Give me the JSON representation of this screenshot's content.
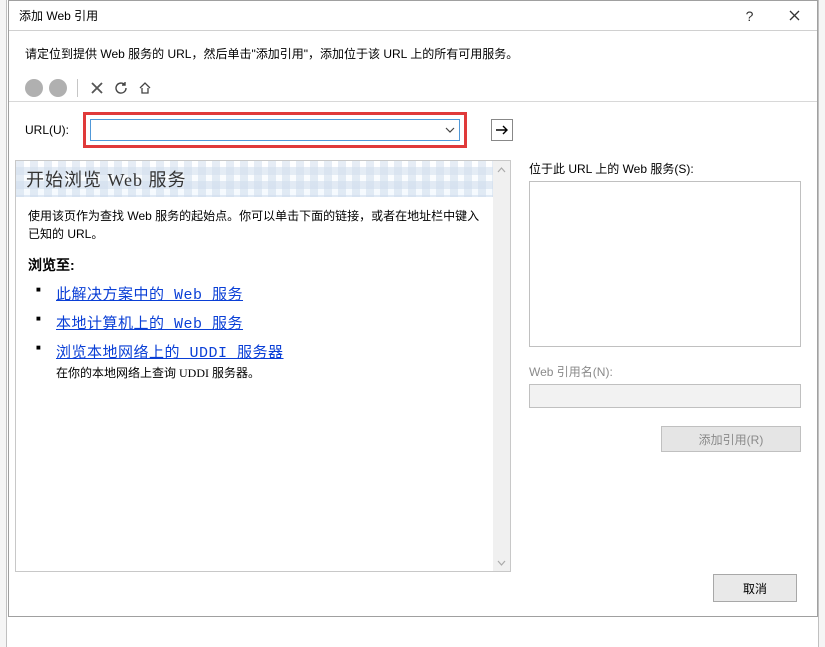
{
  "window": {
    "title": "添加 Web 引用"
  },
  "instruction": "请定位到提供 Web 服务的 URL，然后单击\"添加引用\"，添加位于该 URL 上的所有可用服务。",
  "url": {
    "label": "URL(U):",
    "value": ""
  },
  "browse": {
    "heading": "开始浏览 Web 服务",
    "description": "使用该页作为查找 Web 服务的起始点。你可以单击下面的链接，或者在地址栏中键入已知的 URL。",
    "section_label": "浏览至:",
    "links": [
      {
        "text": "此解决方案中的 Web 服务",
        "sub": ""
      },
      {
        "text": "本地计算机上的 Web 服务",
        "sub": ""
      },
      {
        "text": "浏览本地网络上的 UDDI 服务器",
        "sub": "在你的本地网络上查询 UDDI 服务器。"
      }
    ]
  },
  "right": {
    "services_label": "位于此 URL 上的 Web 服务(S):",
    "refname_label": "Web 引用名(N):",
    "addref_label": "添加引用(R)"
  },
  "footer": {
    "cancel": "取消"
  }
}
